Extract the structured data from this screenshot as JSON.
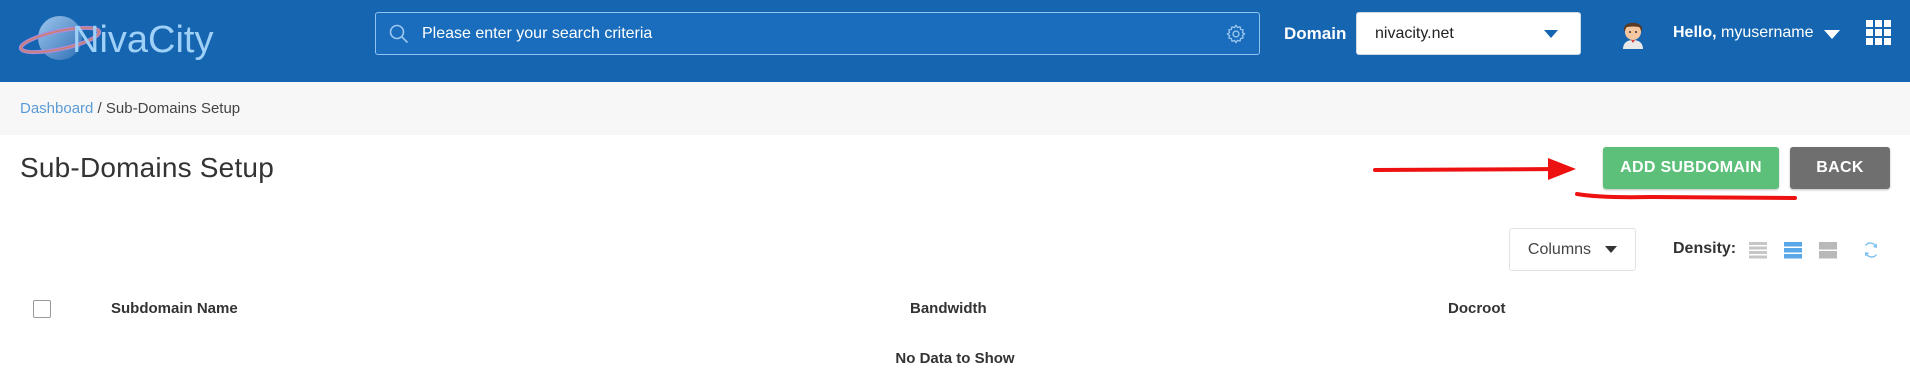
{
  "header": {
    "logo_text": "NivaCity",
    "search_placeholder": "Please enter your search criteria",
    "domain_label": "Domain",
    "domain_value": "nivacity.net",
    "hello_prefix": "Hello,",
    "username": "myusername"
  },
  "breadcrumb": {
    "root": "Dashboard",
    "separator": " / ",
    "current": "Sub-Domains Setup"
  },
  "page": {
    "title": "Sub-Domains Setup",
    "add_button": "ADD SUBDOMAIN",
    "back_button": "BACK"
  },
  "toolbar": {
    "columns_label": "Columns",
    "density_label": "Density:"
  },
  "table": {
    "headers": [
      "Subdomain Name",
      "Bandwidth",
      "Docroot"
    ],
    "empty_message": "No Data to Show"
  },
  "colors": {
    "header_bg": "#1565b0",
    "add_button": "#5cc07a",
    "back_button": "#6f6f6f",
    "annotation": "#ee1111",
    "link": "#5b9bd5"
  }
}
